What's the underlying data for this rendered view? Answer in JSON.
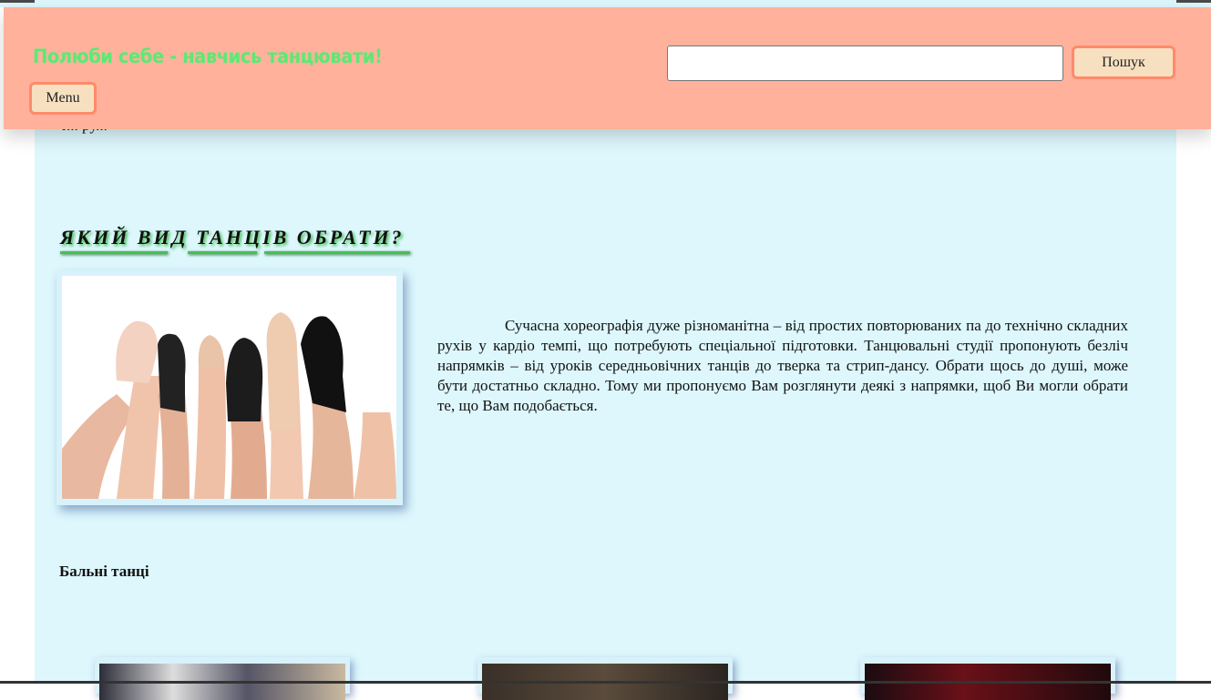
{
  "header": {
    "slogan": "Полюби себе - навчись танцювати!",
    "menu_label": "Menu",
    "search_value": "",
    "search_button_label": "Пошук"
  },
  "content": {
    "hidden_line_fragment": "г... ру...",
    "section_title": "ЯКИЙ ВИД ТАНЦІВ ОБРАТИ?",
    "intro_paragraph": "Сучасна хореографія дуже різноманітна – від простих повторюваних па до технічно складних рухів у кардіо темпі, що потребують спеціальної підготовки. Танцювальні студії пропонують безліч напрямків – від уроків середньовічних танців до тверка та стрип-дансу. Обрати щось до душі, може бути достатньо складно. Тому ми пропонуємо Вам розглянути деякі з напрямки, щоб Ви могли обрати те, що Вам подобається.",
    "subheading": "Бальні танці"
  },
  "colors": {
    "header_bg": "#ffb19c",
    "main_bg": "#ddf7fd",
    "slogan": "#5aea74",
    "button_bg": "#f7e0c0",
    "button_border": "#ff8a6a",
    "title_shadow": "#3fbe50"
  },
  "icons": {
    "hero_image": "dance-shoes-photo",
    "card_images": [
      "ballroom-photo-1",
      "ballroom-photo-2",
      "ballroom-photo-3"
    ]
  }
}
